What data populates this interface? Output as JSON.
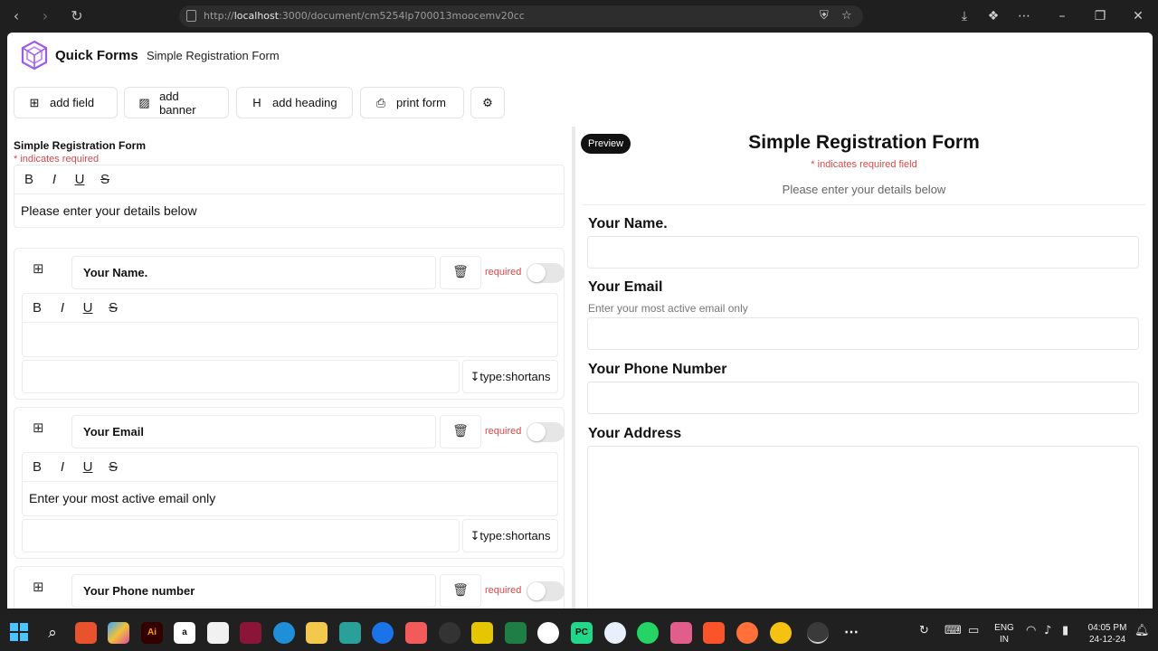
{
  "browser": {
    "url_prefix": "http://",
    "url_host": "localhost",
    "url_rest": ":3000/document/cm5254lp700013moocemv20cc",
    "icons": [
      "back-icon",
      "forward-icon",
      "reload-icon",
      "shield-icon",
      "star-icon",
      "download-icon",
      "extensions-icon",
      "menu-icon",
      "minimize-icon",
      "restore-icon",
      "close-icon"
    ]
  },
  "header": {
    "brand": "Quick Forms",
    "doc_name": "Simple Registration Form",
    "toolbar": {
      "add_field": "add field",
      "add_banner": "add banner",
      "add_heading": "add heading",
      "print_form": "print form"
    }
  },
  "editor": {
    "form_title": "Simple Registration Form",
    "required_note": "* indicates required",
    "description": "Please enter your details below",
    "format_buttons": [
      "B",
      "I",
      "U",
      "S"
    ],
    "fields": [
      {
        "label": "Your Name.",
        "required_label": "required",
        "description": "",
        "type": "type:shortans"
      },
      {
        "label": "Your Email",
        "required_label": "required",
        "description": "Enter your most active email only",
        "type": "type:shortans"
      },
      {
        "label": "Your Phone number",
        "required_label": "required"
      }
    ]
  },
  "preview": {
    "badge": "Preview",
    "title": "Simple Registration Form",
    "required_note": "* indicates required field",
    "description": "Please enter your details below",
    "fields": [
      {
        "label": "Your Name.",
        "help": ""
      },
      {
        "label": "Your Email",
        "help": "Enter your most active email only"
      },
      {
        "label": "Your Phone Number",
        "help": ""
      },
      {
        "label": "Your Address",
        "help": ""
      }
    ]
  },
  "taskbar": {
    "lang_1": "ENG",
    "lang_2": "IN",
    "time": "04:05 PM",
    "date": "24-12-24"
  },
  "colors": {
    "accent_required": "#d94848",
    "brand_logo": "#9b5de5",
    "preview_badge": "#111111"
  }
}
